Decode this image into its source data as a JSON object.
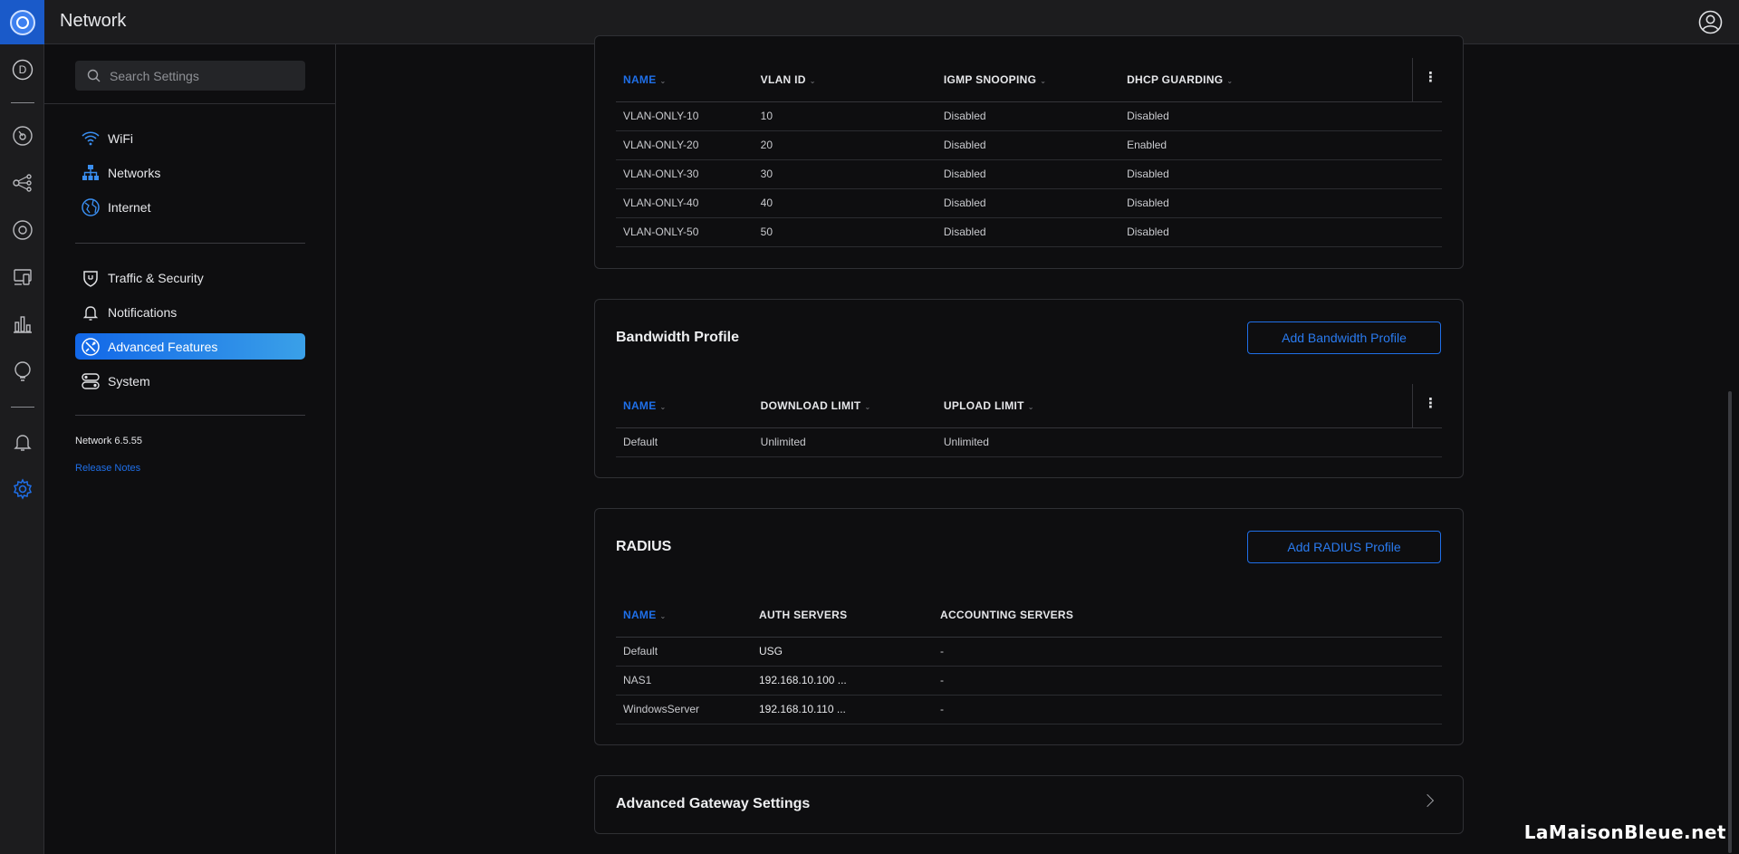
{
  "app": {
    "title": "Network"
  },
  "search": {
    "placeholder": "Search Settings"
  },
  "rail": {
    "avatar_letter": "D",
    "items": [
      {
        "icon": "dashboard-icon"
      },
      {
        "icon": "topology-icon"
      },
      {
        "icon": "devices-icon"
      },
      {
        "icon": "clients-icon"
      },
      {
        "icon": "statistics-icon"
      },
      {
        "icon": "insights-icon"
      },
      {
        "icon": "alerts-icon"
      },
      {
        "icon": "settings-icon",
        "active": true
      }
    ]
  },
  "sidebar": {
    "group1": [
      {
        "label": "WiFi",
        "icon": "wifi-icon"
      },
      {
        "label": "Networks",
        "icon": "networks-icon"
      },
      {
        "label": "Internet",
        "icon": "internet-icon"
      }
    ],
    "group2": [
      {
        "label": "Traffic & Security",
        "icon": "shield-icon"
      },
      {
        "label": "Notifications",
        "icon": "bell-icon"
      },
      {
        "label": "Advanced Features",
        "icon": "advanced-features-icon",
        "active": true
      },
      {
        "label": "System",
        "icon": "system-icon"
      }
    ],
    "version": "Network 6.5.55",
    "release_notes": "Release Notes"
  },
  "vlan_table": {
    "headers": [
      "NAME",
      "VLAN ID",
      "IGMP SNOOPING",
      "DHCP GUARDING"
    ],
    "rows": [
      [
        "VLAN-ONLY-10",
        "10",
        "Disabled",
        "Disabled"
      ],
      [
        "VLAN-ONLY-20",
        "20",
        "Disabled",
        "Enabled"
      ],
      [
        "VLAN-ONLY-30",
        "30",
        "Disabled",
        "Disabled"
      ],
      [
        "VLAN-ONLY-40",
        "40",
        "Disabled",
        "Disabled"
      ],
      [
        "VLAN-ONLY-50",
        "50",
        "Disabled",
        "Disabled"
      ]
    ]
  },
  "bandwidth": {
    "title": "Bandwidth Profile",
    "add_button": "Add Bandwidth Profile",
    "headers": [
      "NAME",
      "DOWNLOAD LIMIT",
      "UPLOAD LIMIT"
    ],
    "rows": [
      [
        "Default",
        "Unlimited",
        "Unlimited"
      ]
    ]
  },
  "radius": {
    "title": "RADIUS",
    "add_button": "Add RADIUS Profile",
    "headers": [
      "NAME",
      "AUTH SERVERS",
      "ACCOUNTING SERVERS"
    ],
    "rows": [
      [
        "Default",
        "USG",
        "-"
      ],
      [
        "NAS1",
        "192.168.10.100 ...",
        "-"
      ],
      [
        "WindowsServer",
        "192.168.10.110 ...",
        "-"
      ]
    ]
  },
  "gateway": {
    "title": "Advanced Gateway Settings"
  },
  "watermark": "LaMaisonBleue.net",
  "colors": {
    "accent": "#1f6fe8",
    "background": "#0e0e10",
    "panel": "#1c1c1e"
  }
}
